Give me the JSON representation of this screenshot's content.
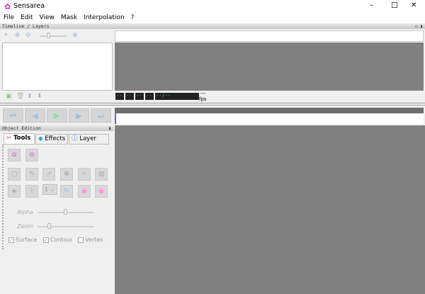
{
  "window": {
    "title": "Sensarea",
    "minimize": "–",
    "maximize": "☐",
    "close": "✕"
  },
  "menu": [
    "File",
    "Edit",
    "View",
    "Mask",
    "Interpolation",
    "?"
  ],
  "timeline": {
    "title": "Timeline / Layers",
    "timecodes": [
      "--",
      "--",
      "--",
      "--",
      "--/--"
    ],
    "fps_value": "---",
    "fps_label": "fps"
  },
  "object_edition": {
    "title": "Object Edition",
    "tabs": [
      "Tools",
      "Effects",
      "Layer info"
    ],
    "brush_size": "1",
    "alpha_label": "Alpha",
    "alpha_value": 0.6,
    "zoom_label": "Zoom",
    "zoom_value": 0.2,
    "checkboxes": [
      {
        "label": "Surface",
        "checked": true
      },
      {
        "label": "Contour",
        "checked": true
      },
      {
        "label": "Vertex",
        "checked": false
      }
    ]
  },
  "colors": {
    "canvas": "#808080",
    "accent": "#cc33cc"
  }
}
